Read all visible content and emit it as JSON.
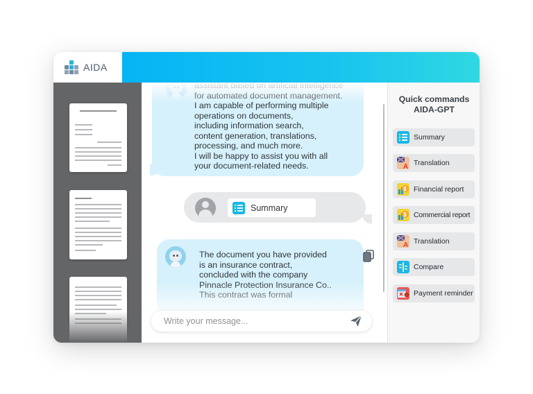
{
  "app": {
    "name": "AIDA"
  },
  "chat": {
    "ai_message_1": "assistant based on artificial intelligence\nfor automated document management.\nI am capable of performing multiple\noperations on documents,\nincluding information search,\ncontent generation, translations,\nprocessing, and much more.\nI will be happy to assist you with all\nyour document-related needs.",
    "user_command": "Summary",
    "ai_message_2": "The document you have provided\nis an insurance contract,\nconcluded with the company\nPinnacle Protection Insurance Co..\nThis contract was formal",
    "input_placeholder": "Write your message..."
  },
  "quick_commands": {
    "title": "Quick commands\nAIDA-GPT",
    "items": [
      {
        "label": "Summary",
        "icon": "summary-list-icon"
      },
      {
        "label": "Translation",
        "icon": "translation-flags-icon"
      },
      {
        "label": "Financial report",
        "icon": "dollar-chart-icon"
      },
      {
        "label": "Commercial report",
        "icon": "dollar-chart-icon"
      },
      {
        "label": "Translation",
        "icon": "translation-flags-icon"
      },
      {
        "label": "Compare",
        "icon": "compare-icon"
      },
      {
        "label": "Payment reminder",
        "icon": "payment-reminder-icon"
      }
    ]
  },
  "colors": {
    "header_gradient_start": "#05b4f5",
    "header_gradient_end": "#2fd8e2",
    "ai_bubble": "#d6f1fb",
    "user_bubble": "#e7e8ea",
    "sidebar": "#646567"
  }
}
